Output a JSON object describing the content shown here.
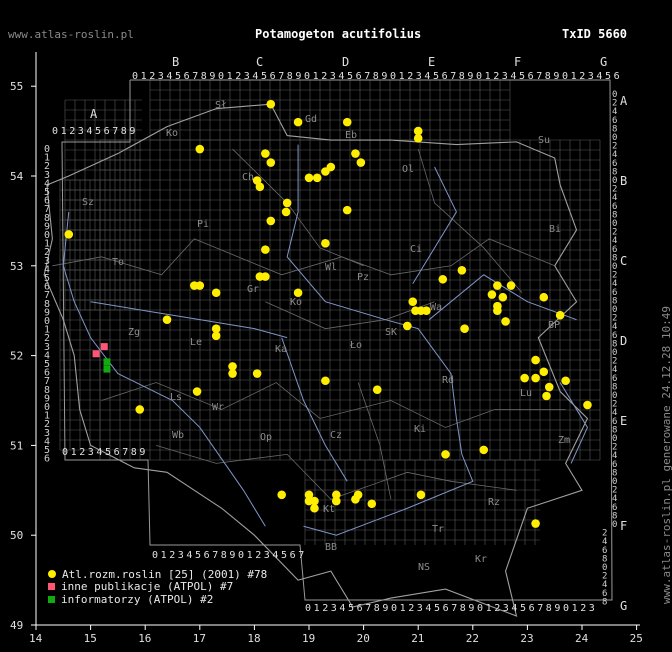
{
  "header": {
    "site": "www.atlas-roslin.pl",
    "title": "Potamogeton acutifolius",
    "taxid": "TxID 5660"
  },
  "footer_vertical": "www.atlas-roslin.pl generowane 24.12.28 10:49",
  "axes": {
    "x_ticks": [
      "14",
      "15",
      "16",
      "17",
      "18",
      "19",
      "20",
      "21",
      "22",
      "23",
      "24",
      "25"
    ],
    "y_ticks": [
      "55",
      "54",
      "53",
      "52",
      "51",
      "50",
      "49"
    ],
    "lon_range": [
      14,
      25
    ],
    "lat_range": [
      49,
      55.5
    ]
  },
  "grid_letters": {
    "top": [
      "A",
      "B",
      "C",
      "D",
      "E",
      "F",
      "G"
    ],
    "right": [
      "A",
      "B",
      "C",
      "D",
      "E",
      "F",
      "G"
    ]
  },
  "regions": [
    "Sł",
    "Gd",
    "Eb",
    "Ko",
    "Su",
    "Ol",
    "Ch",
    "Sz",
    "Bi",
    "Pi",
    "To",
    "Ci",
    "Wl",
    "Gr",
    "Pz",
    "Ko",
    "Ło",
    "SK",
    "Wa",
    "Zg",
    "Le",
    "BP",
    "Ka",
    "Lu",
    "Rd",
    "Wr",
    "Op",
    "Ki",
    "Ls",
    "Wb",
    "Cz",
    "Kt",
    "Zm",
    "Tr",
    "BB",
    "NS",
    "Kr",
    "Rz"
  ],
  "legend": [
    {
      "label": "Atl.rozm.roslin [25] (2001) #78",
      "color": "#ffee00",
      "shape": "dot"
    },
    {
      "label": "inne publikacje (ATPOL) #7",
      "color": "#ff5577",
      "shape": "square"
    },
    {
      "label": "informatorzy (ATPOL) #2",
      "color": "#11aa11",
      "shape": "square"
    }
  ],
  "points_yellow": [
    [
      18.3,
      54.8
    ],
    [
      18.8,
      54.6
    ],
    [
      19.7,
      54.6
    ],
    [
      21.0,
      54.5
    ],
    [
      21.0,
      54.42
    ],
    [
      17.0,
      54.3
    ],
    [
      18.2,
      54.25
    ],
    [
      19.85,
      54.25
    ],
    [
      18.3,
      54.15
    ],
    [
      19.95,
      54.15
    ],
    [
      19.4,
      54.1
    ],
    [
      19.3,
      54.05
    ],
    [
      18.05,
      53.95
    ],
    [
      19.0,
      53.98
    ],
    [
      19.15,
      53.98
    ],
    [
      18.1,
      53.88
    ],
    [
      18.6,
      53.7
    ],
    [
      18.58,
      53.6
    ],
    [
      19.7,
      53.62
    ],
    [
      18.3,
      53.5
    ],
    [
      14.6,
      53.35
    ],
    [
      19.3,
      53.25
    ],
    [
      18.2,
      53.18
    ],
    [
      21.8,
      52.95
    ],
    [
      21.45,
      52.85
    ],
    [
      18.1,
      52.88
    ],
    [
      18.2,
      52.88
    ],
    [
      16.9,
      52.78
    ],
    [
      17.0,
      52.78
    ],
    [
      22.45,
      52.78
    ],
    [
      22.7,
      52.78
    ],
    [
      17.3,
      52.7
    ],
    [
      18.8,
      52.7
    ],
    [
      22.35,
      52.68
    ],
    [
      22.55,
      52.65
    ],
    [
      20.9,
      52.6
    ],
    [
      23.3,
      52.65
    ],
    [
      20.95,
      52.5
    ],
    [
      21.05,
      52.5
    ],
    [
      21.15,
      52.5
    ],
    [
      22.45,
      52.55
    ],
    [
      22.45,
      52.5
    ],
    [
      23.6,
      52.45
    ],
    [
      16.4,
      52.4
    ],
    [
      22.6,
      52.38
    ],
    [
      20.8,
      52.33
    ],
    [
      21.85,
      52.3
    ],
    [
      17.3,
      52.3
    ],
    [
      17.3,
      52.22
    ],
    [
      23.15,
      51.95
    ],
    [
      17.6,
      51.88
    ],
    [
      17.6,
      51.8
    ],
    [
      18.05,
      51.8
    ],
    [
      22.95,
      51.75
    ],
    [
      23.15,
      51.75
    ],
    [
      23.3,
      51.82
    ],
    [
      23.7,
      51.72
    ],
    [
      19.3,
      51.72
    ],
    [
      23.4,
      51.65
    ],
    [
      16.95,
      51.6
    ],
    [
      20.25,
      51.62
    ],
    [
      23.35,
      51.55
    ],
    [
      15.9,
      51.4
    ],
    [
      24.1,
      51.45
    ],
    [
      22.2,
      50.95
    ],
    [
      21.5,
      50.9
    ],
    [
      18.5,
      50.45
    ],
    [
      19.0,
      50.45
    ],
    [
      19.0,
      50.38
    ],
    [
      19.1,
      50.38
    ],
    [
      19.5,
      50.45
    ],
    [
      19.5,
      50.38
    ],
    [
      19.9,
      50.45
    ],
    [
      19.1,
      50.3
    ],
    [
      20.15,
      50.35
    ],
    [
      21.05,
      50.45
    ],
    [
      23.15,
      50.13
    ],
    [
      19.85,
      50.4
    ]
  ],
  "points_pink": [
    [
      15.25,
      52.1
    ],
    [
      15.1,
      52.02
    ]
  ],
  "points_green": [
    [
      15.3,
      51.93
    ],
    [
      15.3,
      51.85
    ]
  ]
}
